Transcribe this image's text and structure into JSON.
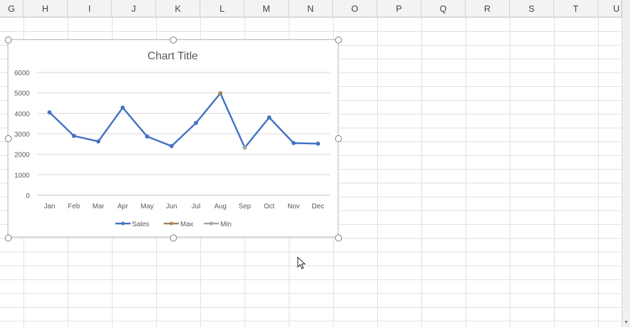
{
  "columns": [
    "G",
    "H",
    "I",
    "J",
    "K",
    "L",
    "M",
    "N",
    "O",
    "P",
    "Q",
    "R",
    "S",
    "T",
    "U"
  ],
  "chart_data": {
    "type": "line",
    "title": "Chart Title",
    "categories": [
      "Jan",
      "Feb",
      "Mar",
      "Apr",
      "May",
      "Jun",
      "Jul",
      "Aug",
      "Sep",
      "Oct",
      "Nov",
      "Dec"
    ],
    "series": [
      {
        "name": "Sales",
        "color": "#4472c4",
        "values": [
          4050,
          2900,
          2630,
          4280,
          2870,
          2400,
          3530,
          4980,
          2330,
          3800,
          2550,
          2520
        ]
      },
      {
        "name": "Max",
        "color": "#a5845a",
        "values": [
          null,
          null,
          null,
          null,
          null,
          null,
          null,
          4980,
          null,
          null,
          null,
          null
        ]
      },
      {
        "name": "Min",
        "color": "#a5a5a5",
        "values": [
          null,
          null,
          null,
          null,
          null,
          null,
          null,
          null,
          2330,
          null,
          null,
          null
        ]
      }
    ],
    "y_ticks": [
      "0",
      "1000",
      "2000",
      "3000",
      "4000",
      "5000",
      "6000"
    ],
    "ylim": [
      0,
      6000
    ],
    "grid": true,
    "legend": "bottom"
  }
}
